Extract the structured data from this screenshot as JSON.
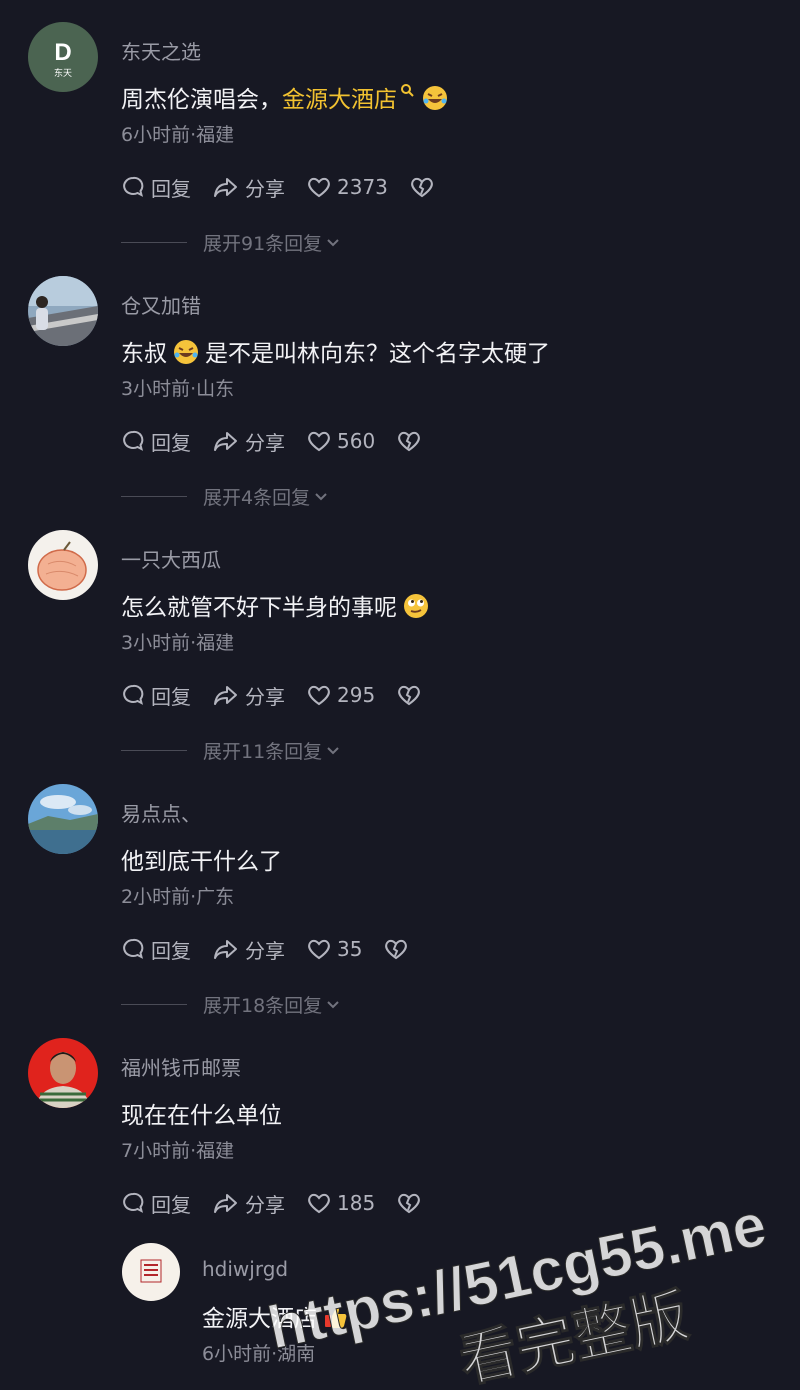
{
  "comments": [
    {
      "username": "东天之选",
      "avatar_letter": "D",
      "avatar_sub": "东天",
      "content_text": "周杰伦演唱会，",
      "content_link": "金源大酒店",
      "content_emoji": "rofl-emoji",
      "meta": "6小时前·福建",
      "reply_label": "回复",
      "share_label": "分享",
      "likes": "2373",
      "expand": "展开91条回复"
    },
    {
      "username": "仓又加错",
      "content_before": "东叔",
      "content_emoji": "rofl-emoji",
      "content_after": "是不是叫林向东？这个名字太硬了",
      "meta": "3小时前·山东",
      "reply_label": "回复",
      "share_label": "分享",
      "likes": "560",
      "expand": "展开4条回复"
    },
    {
      "username": "一只大西瓜",
      "content_text": "怎么就管不好下半身的事呢",
      "content_emoji": "eye-roll-emoji",
      "meta": "3小时前·福建",
      "reply_label": "回复",
      "share_label": "分享",
      "likes": "295",
      "expand": "展开11条回复"
    },
    {
      "username": "易点点、",
      "content_text": "他到底干什么了",
      "meta": "2小时前·广东",
      "reply_label": "回复",
      "share_label": "分享",
      "likes": "35",
      "expand": "展开18条回复"
    },
    {
      "username": "福州钱币邮票",
      "content_text": "现在在什么单位",
      "meta": "7小时前·福建",
      "reply_label": "回复",
      "share_label": "分享",
      "likes": "185"
    }
  ],
  "reply": {
    "username": "hdiwjrgd",
    "content_text": "金源大酒店",
    "content_emoji": "thumbs-up-emoji",
    "meta": "6小时前·湖南"
  },
  "watermark": {
    "url": "https://51cg55.me",
    "subtitle": "看完整版"
  },
  "colors": {
    "background": "#171823",
    "link": "#f2c230",
    "muted": "#8c8d98"
  }
}
